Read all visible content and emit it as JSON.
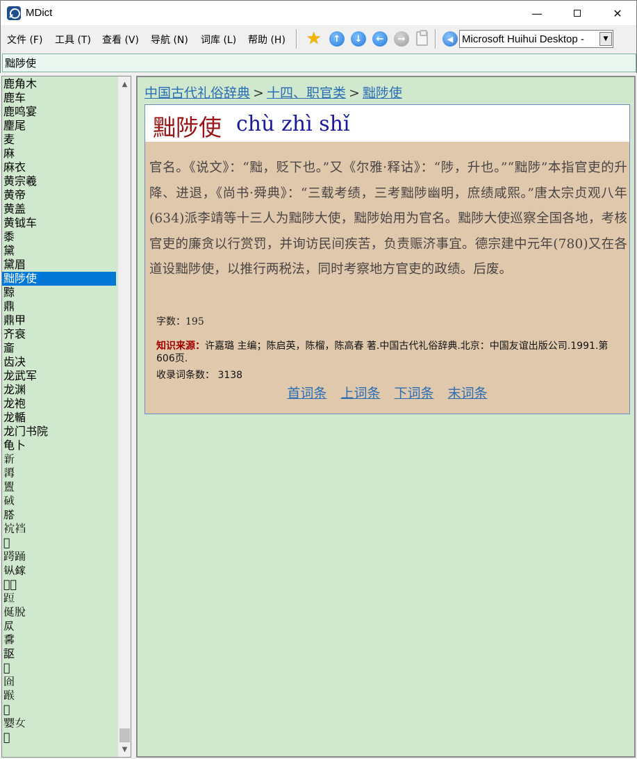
{
  "window": {
    "title": "MDict",
    "minimize": "—",
    "close": "✕"
  },
  "menu": {
    "items": [
      "文件 (F)",
      "工具 (T)",
      "查看 (V)",
      "导航 (N)",
      "词库 (L)",
      "帮助 (H)"
    ]
  },
  "toolbar": {
    "icons": [
      "favorite-star-icon",
      "up-arrow-icon",
      "down-arrow-icon",
      "back-arrow-icon",
      "forward-arrow-icon",
      "clipboard-icon",
      "speaker-icon"
    ],
    "voice_value": "Microsoft Huihui Desktop -"
  },
  "search": {
    "value": "黜陟使"
  },
  "wordlist": {
    "items": [
      "鹿角木",
      "鹿车",
      "鹿鸣宴",
      "麈尾",
      "麦",
      "麻",
      "麻衣",
      "黄宗羲",
      "黄帝",
      "黄盖",
      "黄钺车",
      "黍",
      "黛",
      "黛眉",
      "黜陟使",
      "黥",
      "鼎",
      "鼎甲",
      "齐衰",
      "齑",
      "齿决",
      "龙武军",
      "龙渊",
      "龙袍",
      "龙輴",
      "龙门书院",
      "龟卜",
      "𣂺",
      "𩓾",
      "𥃝",
      "𥑳",
      "𦞂",
      "𧙇裆",
      "𩨆",
      "𨃖踊",
      "𫓩鎵",
      "𩋚𩌦",
      "𨁋",
      "𠈰脱",
      "𪨊",
      "𩡌",
      "𧦅",
      "𨗳",
      "𡇞",
      "𨂸",
      "𫗃",
      "𡣠女",
      "𩨇"
    ],
    "selected_index": 14
  },
  "content": {
    "breadcrumb": [
      "中国古代礼俗辞典",
      "十四、职官类",
      "黜陟使"
    ],
    "crumb_sep": ">",
    "headword": "黜陟使",
    "pinyin": "chù zhì shǐ",
    "definition": "官名。《说文》：“黜，贬下也。”又《尔雅·释诂》：“陟，升也。”“黜陟”本指官吏的升降、进退，《尚书·舜典》：“三载考绩，三考黜陟幽明，庶绩咸熙。”唐太宗贞观八年(634)派李靖等十三人为黜陟大使，黜陟始用为官名。黜陟大使巡察全国各地，考核官吏的廉贪以行赏罚，并询访民间疾苦，负责赈济事宜。德宗建中元年(780)又在各道设黜陟使，以推行两税法，同时考察地方官吏的政绩。后废。",
    "char_count": "字数：195",
    "source_label": "知识来源：",
    "source_text": "许嘉璐 主编；陈启英，陈榴，陈高春 著.中国古代礼俗辞典.北京：中国友谊出版公司.1991.第606页.",
    "entry_count_label": "收录词条数：",
    "entry_count": "3138",
    "nav": {
      "first": "首词条",
      "prev": "上词条",
      "next": "下词条",
      "last": "末词条"
    }
  },
  "colors": {
    "list_bg": "#d0e8ce",
    "selected_bg": "#0078d7",
    "entry_bg": "#e0c8ad",
    "headword": "#9a1515",
    "pinyin": "#1a1aa0",
    "link": "#2a6db3",
    "source_label": "#a00000"
  }
}
